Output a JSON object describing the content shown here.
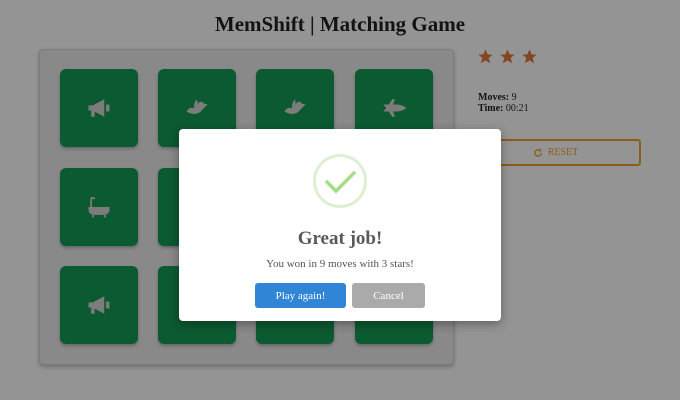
{
  "header": {
    "title": "MemShift | Matching Game"
  },
  "score_panel": {
    "rating": 3,
    "rating_max": 3,
    "star_color": "#e07b39",
    "moves_label": "Moves:",
    "moves_value": "9",
    "time_label": "Time:",
    "time_value": "00:21",
    "reset_label": "RESET",
    "reset_icon": "redo-icon"
  },
  "board": {
    "card_color": "#169b55",
    "cards": [
      {
        "icon": "bullhorn-icon",
        "state": "open"
      },
      {
        "icon": "dove-icon",
        "state": "open"
      },
      {
        "icon": "dove-icon",
        "state": "open"
      },
      {
        "icon": "space-shuttle-icon",
        "state": "open"
      },
      {
        "icon": "bath-icon",
        "state": "open"
      },
      {
        "icon": "",
        "state": "open"
      },
      {
        "icon": "",
        "state": "open"
      },
      {
        "icon": "",
        "state": "open"
      },
      {
        "icon": "bullhorn-icon",
        "state": "open"
      },
      {
        "icon": "",
        "state": "open"
      },
      {
        "icon": "",
        "state": "open"
      },
      {
        "icon": "",
        "state": "open"
      }
    ]
  },
  "modal": {
    "icon": "success-check-icon",
    "title": "Great job!",
    "message": "You won in 9 moves with 3 stars!",
    "confirm_label": "Play again!",
    "cancel_label": "Cancel",
    "confirm_color": "#3085d6",
    "cancel_color": "#aaaaaa"
  }
}
